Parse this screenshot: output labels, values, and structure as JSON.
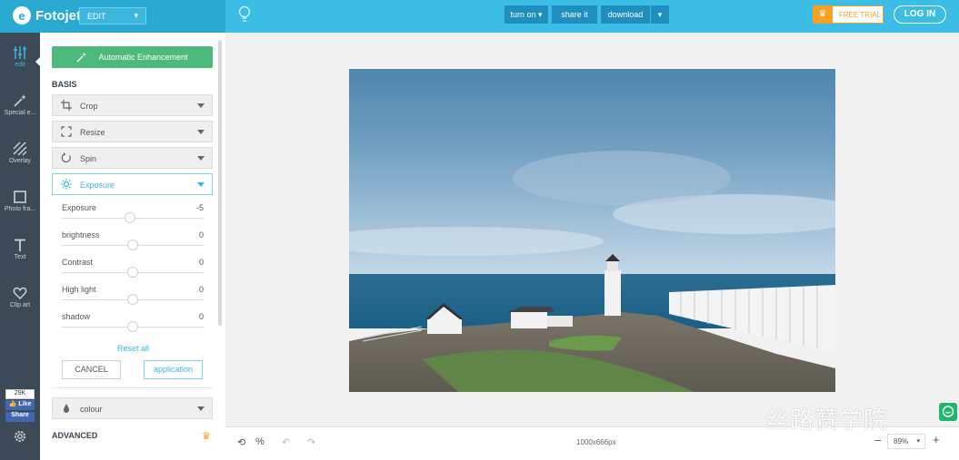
{
  "app": {
    "name": "Fotojet",
    "mode": "EDIT"
  },
  "toolbar": {
    "turn_on": "turn on",
    "share": "share it",
    "download": "download",
    "free_trial": "FREE TRIAL",
    "login": "LOG IN"
  },
  "rail": {
    "items": [
      {
        "label": "edit",
        "icon": "sliders-icon"
      },
      {
        "label": "Special e...",
        "icon": "magic-wand-icon"
      },
      {
        "label": "Overlay",
        "icon": "overlay-icon"
      },
      {
        "label": "Photo fra...",
        "icon": "frame-icon"
      },
      {
        "label": "Text",
        "icon": "text-icon"
      },
      {
        "label": "Clip art",
        "icon": "heart-icon"
      }
    ],
    "fb_count": "29K",
    "fb_like": "Like",
    "fb_share": "Share"
  },
  "panel": {
    "auto_enhance": "Automatic Enhancement",
    "basis_title": "BASIS",
    "crop": "Crop",
    "resize": "Resize",
    "spin": "Spin",
    "exposure": "Exposure",
    "sliders": [
      {
        "label": "Exposure",
        "value": "-5",
        "level": 0.48
      },
      {
        "label": "brightness",
        "value": "0",
        "level": 0.5
      },
      {
        "label": "Contrast",
        "value": "0",
        "level": 0.5
      },
      {
        "label": "High light",
        "value": "0",
        "level": 0.5
      },
      {
        "label": "shadow",
        "value": "0",
        "level": 0.5
      }
    ],
    "reset": "Reset all",
    "cancel": "CANCEL",
    "apply": "application",
    "colour": "colour",
    "advanced": "ADVANCED"
  },
  "canvas": {
    "dimensions": "1000x666px",
    "zoom": "89%"
  },
  "watermark": "丝路赞学院",
  "colors": {
    "accent": "#3bbde5",
    "green": "#4cba7a",
    "rail": "#3c4a58",
    "orange": "#f7a024"
  }
}
